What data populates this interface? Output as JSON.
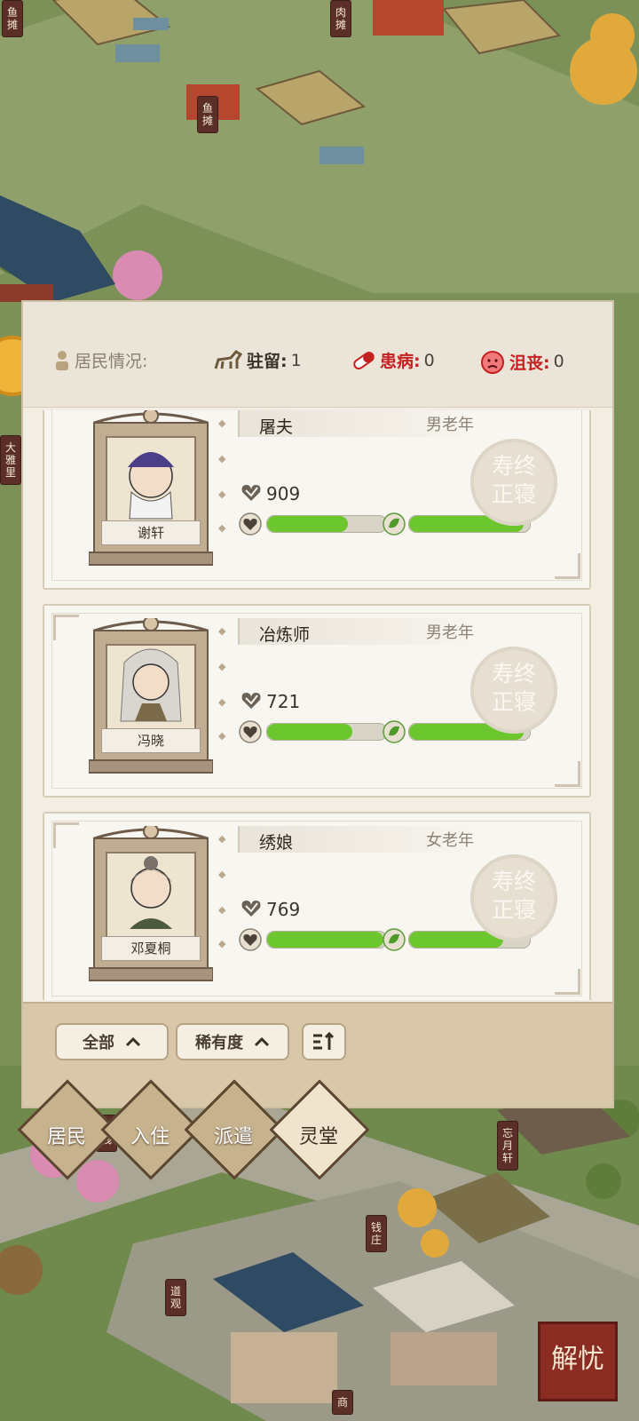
{
  "map_signs": [
    {
      "id": "sign-fish-1",
      "text": "鱼摊"
    },
    {
      "id": "sign-meat",
      "text": "肉摊"
    },
    {
      "id": "sign-fish-2",
      "text": "鱼摊"
    },
    {
      "id": "sign-daya",
      "text": "大雅里"
    },
    {
      "id": "sign-kezhan",
      "text": "客栈"
    },
    {
      "id": "sign-wangyue",
      "text": "忘月轩"
    },
    {
      "id": "sign-qianzhuang",
      "text": "钱庄"
    },
    {
      "id": "sign-daoguan",
      "text": "道观"
    },
    {
      "id": "sign-shang",
      "text": "商"
    }
  ],
  "stats": {
    "title": "居民情况:",
    "stay_label": "驻留:",
    "stay_value": "1",
    "sick_label": "患病:",
    "sick_value": "0",
    "sad_label": "沮丧:",
    "sad_value": "0"
  },
  "residents": [
    {
      "name": "谢轩",
      "job": "屠夫",
      "age_gender": "男老年",
      "value": "909",
      "health": 0.68,
      "mood": 0.95,
      "stamp_top": "寿终",
      "stamp_bottom": "正寝",
      "color": "#4b3f8a"
    },
    {
      "name": "冯晓",
      "job": "冶炼师",
      "age_gender": "男老年",
      "value": "721",
      "health": 0.72,
      "mood": 0.95,
      "stamp_top": "寿终",
      "stamp_bottom": "正寝",
      "color": "#7a7a74"
    },
    {
      "name": "邓夏桐",
      "job": "绣娘",
      "age_gender": "女老年",
      "value": "769",
      "health": 0.98,
      "mood": 0.78,
      "stamp_top": "寿终",
      "stamp_bottom": "正寝",
      "color": "#6e5a52"
    }
  ],
  "filters": {
    "all": "全部",
    "rarity": "稀有度",
    "sort_icon": "sort-icon"
  },
  "tabs": [
    {
      "label": "居民",
      "active": false
    },
    {
      "label": "入住",
      "active": false
    },
    {
      "label": "派遣",
      "active": false
    },
    {
      "label": "灵堂",
      "active": true
    }
  ],
  "corner_button": "解忧",
  "colors": {
    "bar_fill": "#6cc62e",
    "alert_red": "#c42020"
  }
}
